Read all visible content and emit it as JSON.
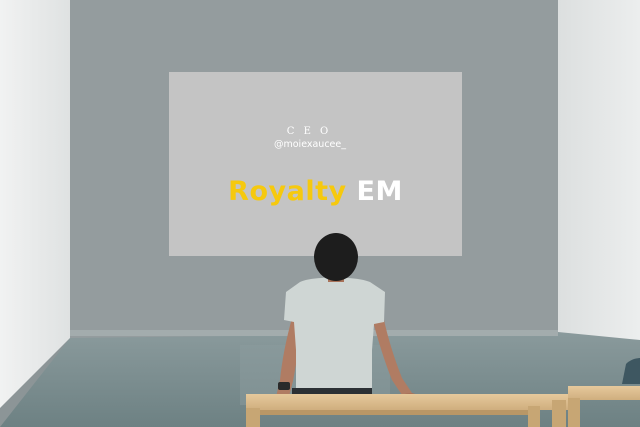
{
  "projection": {
    "title_line": "C E O",
    "handle": "@moiexaucee_",
    "brand_first": "Royalty",
    "brand_second": "EM"
  },
  "colors": {
    "brand_gold": "#f6c90e",
    "text_white": "#ffffff",
    "back_wall": "#949c9e",
    "side_wall": "#e8eaea",
    "screen": "#c4c4c4",
    "floor": "#77898b",
    "bench_wood": "#d9b98b"
  }
}
